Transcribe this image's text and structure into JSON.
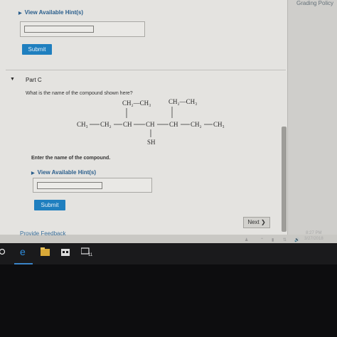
{
  "header": {
    "grading_policy": "Grading Policy"
  },
  "part_b": {
    "hint_link": "View Available Hint(s)",
    "submit_label": "Submit"
  },
  "part_c": {
    "label": "Part C",
    "question": "What is the name of the compound shown here?",
    "structure": {
      "top_left_group": "CH₂—CH₃",
      "top_right_group": "CH₂—CH₃",
      "main_chain": [
        "CH₃",
        "CH₂",
        "CH",
        "CH",
        "CH",
        "CH₂",
        "CH₃"
      ],
      "substituent": "SH"
    },
    "prompt": "Enter the name of the compound.",
    "hint_link": "View Available Hint(s)",
    "submit_label": "Submit"
  },
  "footer": {
    "next_label": "Next ❯",
    "feedback_link": "Provide Feedback"
  },
  "taskbar": {
    "icons": [
      "cortana-icon",
      "edge-icon",
      "file-explorer-icon",
      "store-icon",
      "app-icon"
    ],
    "clock_time": "8:27 PM",
    "clock_date": "3/27/2018"
  },
  "colors": {
    "accent": "#1f7fbf",
    "link": "#2a5e8c",
    "taskbar": "#1a1a1c"
  }
}
